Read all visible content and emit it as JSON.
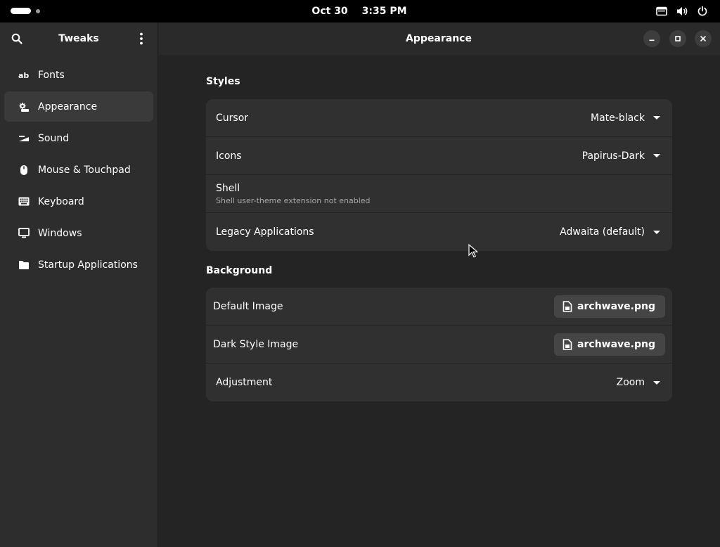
{
  "topbar": {
    "date": "Oct 30",
    "time": "3:35 PM",
    "icons": [
      "screen-icon",
      "volume-icon",
      "power-icon"
    ]
  },
  "sidebar": {
    "title": "Tweaks",
    "items": [
      {
        "label": "Fonts",
        "icon": "fonts-icon"
      },
      {
        "label": "Appearance",
        "icon": "appearance-icon",
        "active": true
      },
      {
        "label": "Sound",
        "icon": "sound-icon"
      },
      {
        "label": "Mouse & Touchpad",
        "icon": "mouse-icon"
      },
      {
        "label": "Keyboard",
        "icon": "keyboard-icon"
      },
      {
        "label": "Windows",
        "icon": "windows-icon"
      },
      {
        "label": "Startup Applications",
        "icon": "folder-icon"
      }
    ]
  },
  "main": {
    "title": "Appearance",
    "styles": {
      "heading": "Styles",
      "cursor": {
        "label": "Cursor",
        "value": "Mate-black"
      },
      "icons": {
        "label": "Icons",
        "value": "Papirus-Dark"
      },
      "shell": {
        "label": "Shell",
        "subtitle": "Shell user-theme extension not enabled"
      },
      "legacy": {
        "label": "Legacy Applications",
        "value": "Adwaita (default)"
      }
    },
    "background": {
      "heading": "Background",
      "default_image": {
        "label": "Default Image",
        "file": "archwave.png"
      },
      "dark_image": {
        "label": "Dark Style Image",
        "file": "archwave.png"
      },
      "adjustment": {
        "label": "Adjustment",
        "value": "Zoom"
      }
    }
  },
  "colors": {
    "window_bg": "#242424",
    "sidebar_bg": "#2d2d2d",
    "card_bg": "#303030",
    "accent_text": "#ffffff"
  }
}
